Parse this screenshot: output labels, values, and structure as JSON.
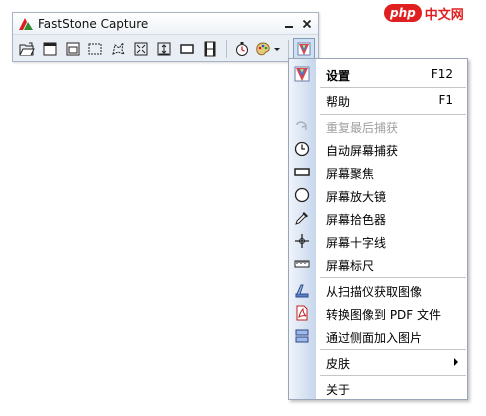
{
  "window": {
    "title": "FastStone Capture"
  },
  "toolbar": {
    "buttons": [
      "open-folder-icon",
      "capture-window-icon",
      "capture-object-icon",
      "capture-rectangle-icon",
      "capture-freehand-icon",
      "capture-fullscreen-icon",
      "capture-scrolling-icon",
      "capture-fixed-region-icon",
      "capture-video-icon",
      "delay-timer-icon",
      "output-palette-icon",
      "settings-menu-icon"
    ]
  },
  "menu": {
    "items": [
      {
        "label": "设置",
        "shortcut": "F12",
        "icon": "settings-icon",
        "bold": true
      },
      {
        "label": "帮助",
        "shortcut": "F1",
        "icon": ""
      },
      {
        "label": "重复最后捕获",
        "icon": "repeat-icon",
        "disabled": true
      },
      {
        "label": "自动屏幕捕获",
        "icon": "clock-icon"
      },
      {
        "label": "屏幕聚焦",
        "icon": "rectangle-icon"
      },
      {
        "label": "屏幕放大镜",
        "icon": "magnifier-icon"
      },
      {
        "label": "屏幕拾色器",
        "icon": "eyedropper-icon"
      },
      {
        "label": "屏幕十字线",
        "icon": "crosshair-icon"
      },
      {
        "label": "屏幕标尺",
        "icon": "ruler-icon"
      },
      {
        "label": "从扫描仪获取图像",
        "icon": "scanner-icon"
      },
      {
        "label": "转换图像到 PDF 文件",
        "icon": "pdf-icon"
      },
      {
        "label": "通过侧面加入图片",
        "icon": "join-images-icon"
      },
      {
        "label": "皮肤",
        "icon": "",
        "submenu": true
      },
      {
        "label": "关于",
        "icon": ""
      }
    ]
  },
  "watermark": {
    "pill": "php",
    "text": "中文网"
  },
  "colors": {
    "accent_red": "#e02020",
    "menu_gutter": "#c7d6ec",
    "toolbar_bg": "#e9eef5"
  }
}
